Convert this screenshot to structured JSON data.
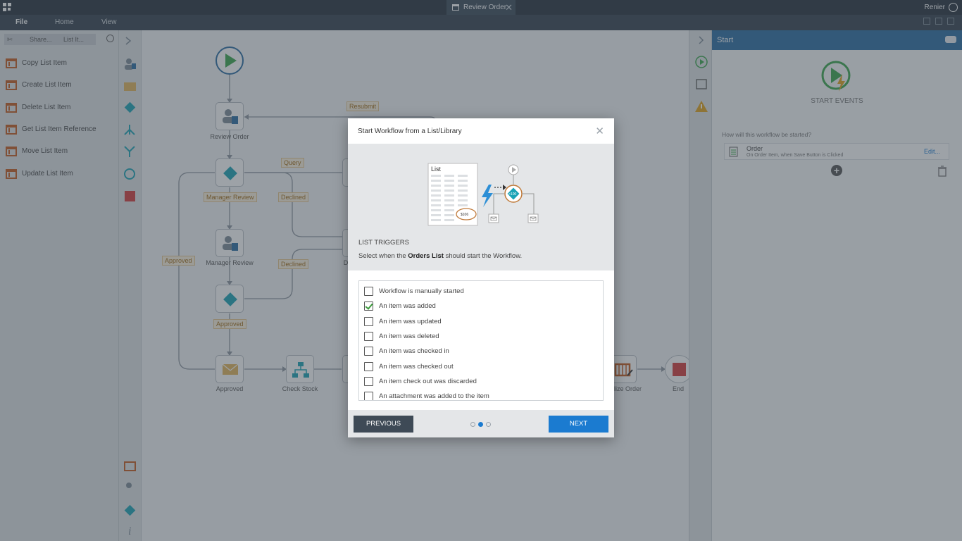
{
  "window": {
    "tab_title": "Review Order",
    "user_name": "Renier"
  },
  "menu": {
    "items": [
      "File",
      "Home",
      "View"
    ]
  },
  "toolbox": {
    "breadcrumbs": [
      "Share...",
      "List It..."
    ],
    "items": [
      "Copy List Item",
      "Create List Item",
      "Delete List Item",
      "Get List Item Reference",
      "Move List Item",
      "Update List Item"
    ]
  },
  "canvas": {
    "nodes": {
      "review_order": "Review Order",
      "manager_review": "Manager Review",
      "approved": "Approved",
      "check_stock": "Check Stock",
      "finalize_order": "lize Order",
      "end": "End",
      "partial_d": "D"
    },
    "edge_labels": {
      "resubmit": "Resubmit",
      "query": "Query",
      "manager_review": "Manager Review",
      "declined_1": "Declined",
      "declined_2": "Declined",
      "approved_left": "Approved",
      "approved_mid": "Approved"
    }
  },
  "properties": {
    "title": "Start",
    "section_label": "START EVENTS",
    "question": "How will this workflow be started?",
    "event_name": "Order",
    "event_detail": "On Order Item, when Save Button is Clicked",
    "edit_link": "Edit..."
  },
  "dialog": {
    "title": "Start Workflow from a List/Library",
    "illustration": {
      "list_label": "List",
      "price_label": "$106",
      "decision_label": ">100"
    },
    "section": "LIST TRIGGERS",
    "description_prefix": "Select when the ",
    "description_bold": "Orders List",
    "description_suffix": " should start the Workflow.",
    "options": [
      {
        "label": "Workflow is manually started",
        "checked": false
      },
      {
        "label": "An item was added",
        "checked": true
      },
      {
        "label": "An item was updated",
        "checked": false
      },
      {
        "label": "An item was deleted",
        "checked": false
      },
      {
        "label": "An item was checked in",
        "checked": false
      },
      {
        "label": "An item was checked out",
        "checked": false
      },
      {
        "label": "An item check out was discarded",
        "checked": false
      },
      {
        "label": "An attachment was added to the item",
        "checked": false
      }
    ],
    "previous_label": "PREVIOUS",
    "next_label": "NEXT",
    "page_indicator": {
      "current": 2,
      "total": 3
    }
  },
  "colors": {
    "accent": "#1b7bd0",
    "teal": "#1aa3b5",
    "start_green": "#3aa64c",
    "end_red": "#d53a3a",
    "edge_label_text": "#a06a14"
  }
}
